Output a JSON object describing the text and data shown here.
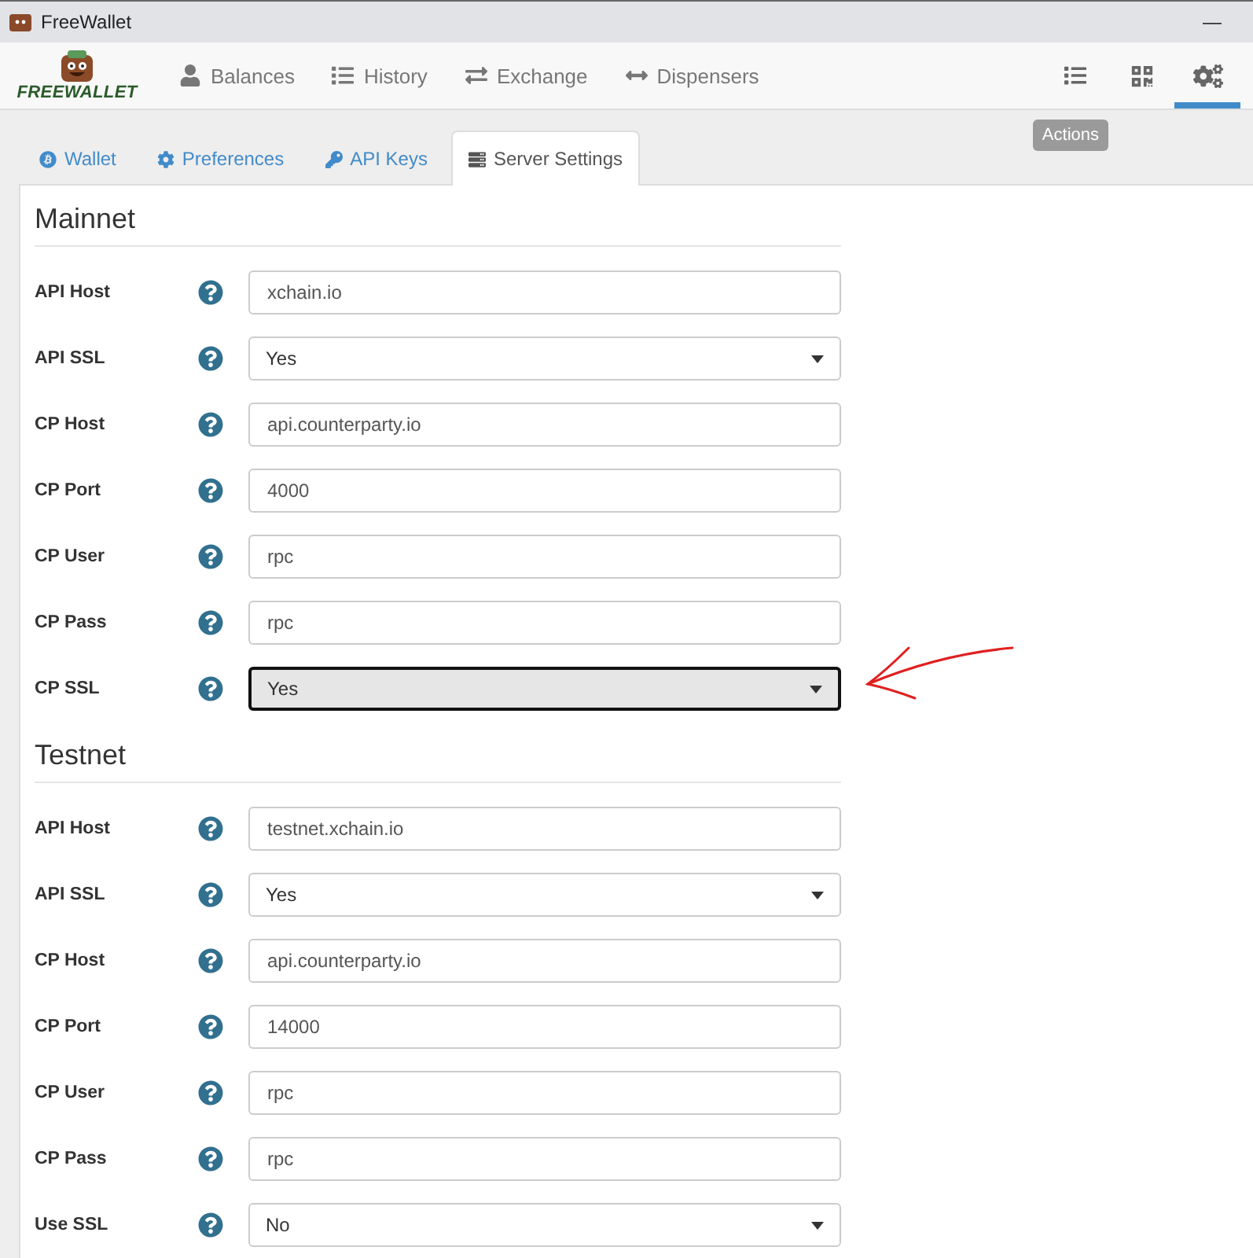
{
  "window": {
    "title": "FreeWallet",
    "minimize": "—"
  },
  "logo": {
    "text": "FREEWALLET"
  },
  "nav": {
    "items": [
      {
        "label": "Balances",
        "selected": false
      },
      {
        "label": "History",
        "selected": false
      },
      {
        "label": "Exchange",
        "selected": false
      },
      {
        "label": "Dispensers",
        "selected": false
      }
    ],
    "actions": [
      {
        "selected": false
      },
      {
        "selected": false
      },
      {
        "selected": true
      }
    ],
    "tooltip": "Actions"
  },
  "tabs": [
    {
      "label": "Wallet",
      "selected": false
    },
    {
      "label": "Preferences",
      "selected": false
    },
    {
      "label": "API Keys",
      "selected": false
    },
    {
      "label": "Server Settings",
      "selected": true
    }
  ],
  "sections": [
    {
      "title": "Mainnet",
      "fields": [
        {
          "label": "API Host",
          "kind": "text",
          "value": "xchain.io",
          "focused": false
        },
        {
          "label": "API SSL",
          "kind": "select",
          "value": "Yes",
          "focused": false
        },
        {
          "label": "CP Host",
          "kind": "text",
          "value": "api.counterparty.io",
          "focused": false
        },
        {
          "label": "CP Port",
          "kind": "text",
          "value": "4000",
          "focused": false
        },
        {
          "label": "CP User",
          "kind": "text",
          "value": "rpc",
          "focused": false
        },
        {
          "label": "CP Pass",
          "kind": "text",
          "value": "rpc",
          "focused": false
        },
        {
          "label": "CP SSL",
          "kind": "select",
          "value": "Yes",
          "focused": true,
          "annotated": true
        }
      ]
    },
    {
      "title": "Testnet",
      "fields": [
        {
          "label": "API Host",
          "kind": "text",
          "value": "testnet.xchain.io",
          "focused": false
        },
        {
          "label": "API SSL",
          "kind": "select",
          "value": "Yes",
          "focused": false
        },
        {
          "label": "CP Host",
          "kind": "text",
          "value": "api.counterparty.io",
          "focused": false
        },
        {
          "label": "CP Port",
          "kind": "text",
          "value": "14000",
          "focused": false
        },
        {
          "label": "CP User",
          "kind": "text",
          "value": "rpc",
          "focused": false
        },
        {
          "label": "CP Pass",
          "kind": "text",
          "value": "rpc",
          "focused": false
        },
        {
          "label": "Use SSL",
          "kind": "select",
          "value": "No",
          "focused": false
        }
      ]
    }
  ]
}
